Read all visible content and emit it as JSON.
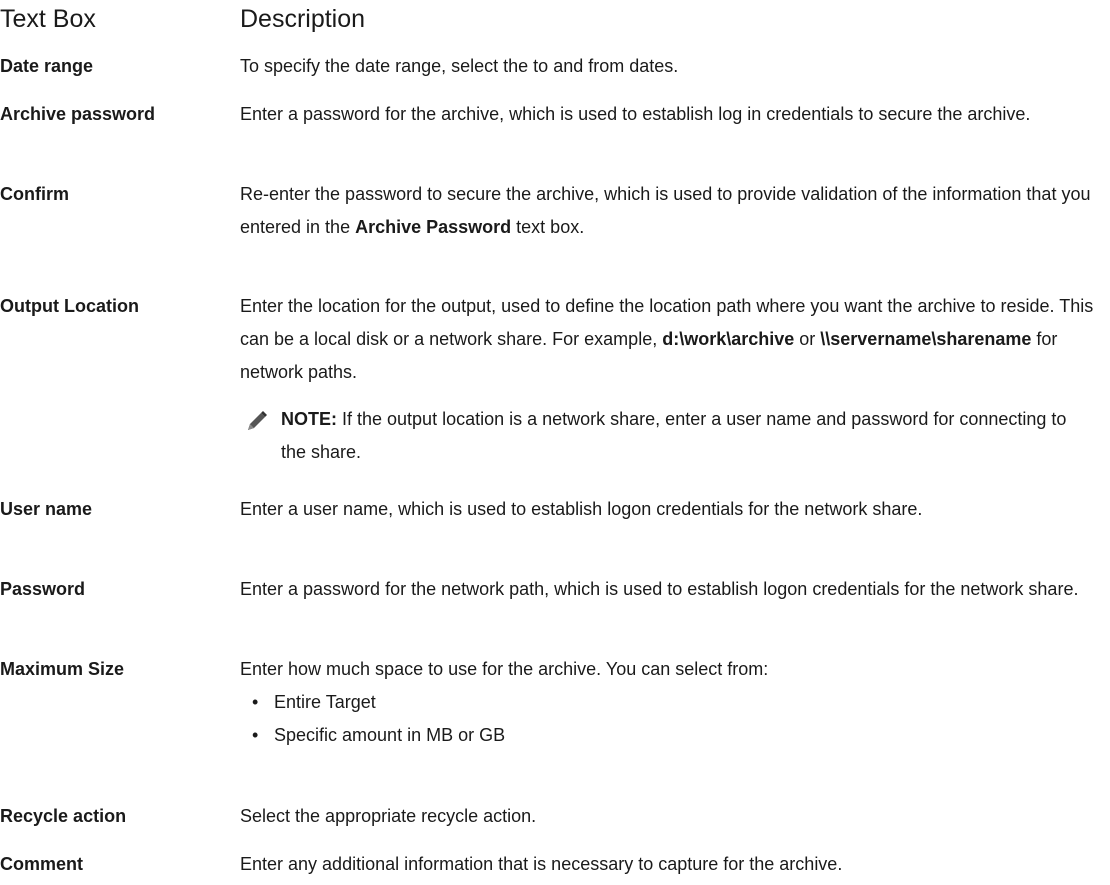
{
  "header": {
    "col1": "Text Box",
    "col2": "Description"
  },
  "rows": {
    "date_range": {
      "label": "Date range",
      "desc": "To specify the date range, select the to and from dates."
    },
    "archive_password": {
      "label": "Archive password",
      "desc": "Enter a password for the archive, which is used to establish log in credentials to secure the archive."
    },
    "confirm": {
      "label": "Confirm",
      "desc_before": "Re-enter the password to secure the archive, which is used to provide validation of the information that you entered in the ",
      "desc_bold": "Archive Password",
      "desc_after": " text box."
    },
    "output_location": {
      "label": "Output Location",
      "desc_1": "Enter the location for the output, used to define the location path where you want the archive to reside. This can be a local disk or a network share. For example, ",
      "path_1": "d:\\work\\archive",
      "desc_2": " or ",
      "path_2": "\\\\servername\\sharename",
      "desc_3": " for network paths.",
      "note_label": "NOTE:",
      "note_text": " If the output location is a network share, enter a user name and password for connecting to the share."
    },
    "user_name": {
      "label": "User name",
      "desc": "Enter a user name, which is used to establish logon credentials for the network share."
    },
    "password": {
      "label": "Password",
      "desc": "Enter a password for the network path, which is used to establish logon credentials for the network share."
    },
    "maximum_size": {
      "label": "Maximum Size",
      "desc": "Enter how much space to use for the archive. You can select from:",
      "options": [
        "Entire Target",
        "Specific amount in MB or GB"
      ],
      "bullet": "•"
    },
    "recycle_action": {
      "label": "Recycle action",
      "desc": "Select the appropriate recycle action."
    },
    "comment": {
      "label": "Comment",
      "desc": "Enter any additional information that is necessary to capture for the archive."
    }
  },
  "icons": {
    "note": "pencil-note-icon"
  }
}
